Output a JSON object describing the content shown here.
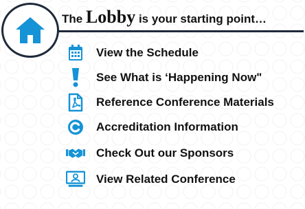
{
  "header": {
    "title_prefix": "The ",
    "title_emphasis": "Lobby",
    "title_suffix": " is your starting point…"
  },
  "colors": {
    "accent": "#1593d6",
    "dark": "#1f2a3a",
    "text": "#111111"
  },
  "items": [
    {
      "icon": "calendar-icon",
      "label": "View the Schedule"
    },
    {
      "icon": "exclamation-icon",
      "label": "See What is ‘Happening Now\""
    },
    {
      "icon": "pdf-document-icon",
      "label": "Reference Conference Materials"
    },
    {
      "icon": "credit-c-icon",
      "label": "Accreditation Information"
    },
    {
      "icon": "sponsors-icon",
      "label": "Check Out our Sponsors"
    },
    {
      "icon": "presentation-icon",
      "label": "View Related Conference"
    }
  ]
}
